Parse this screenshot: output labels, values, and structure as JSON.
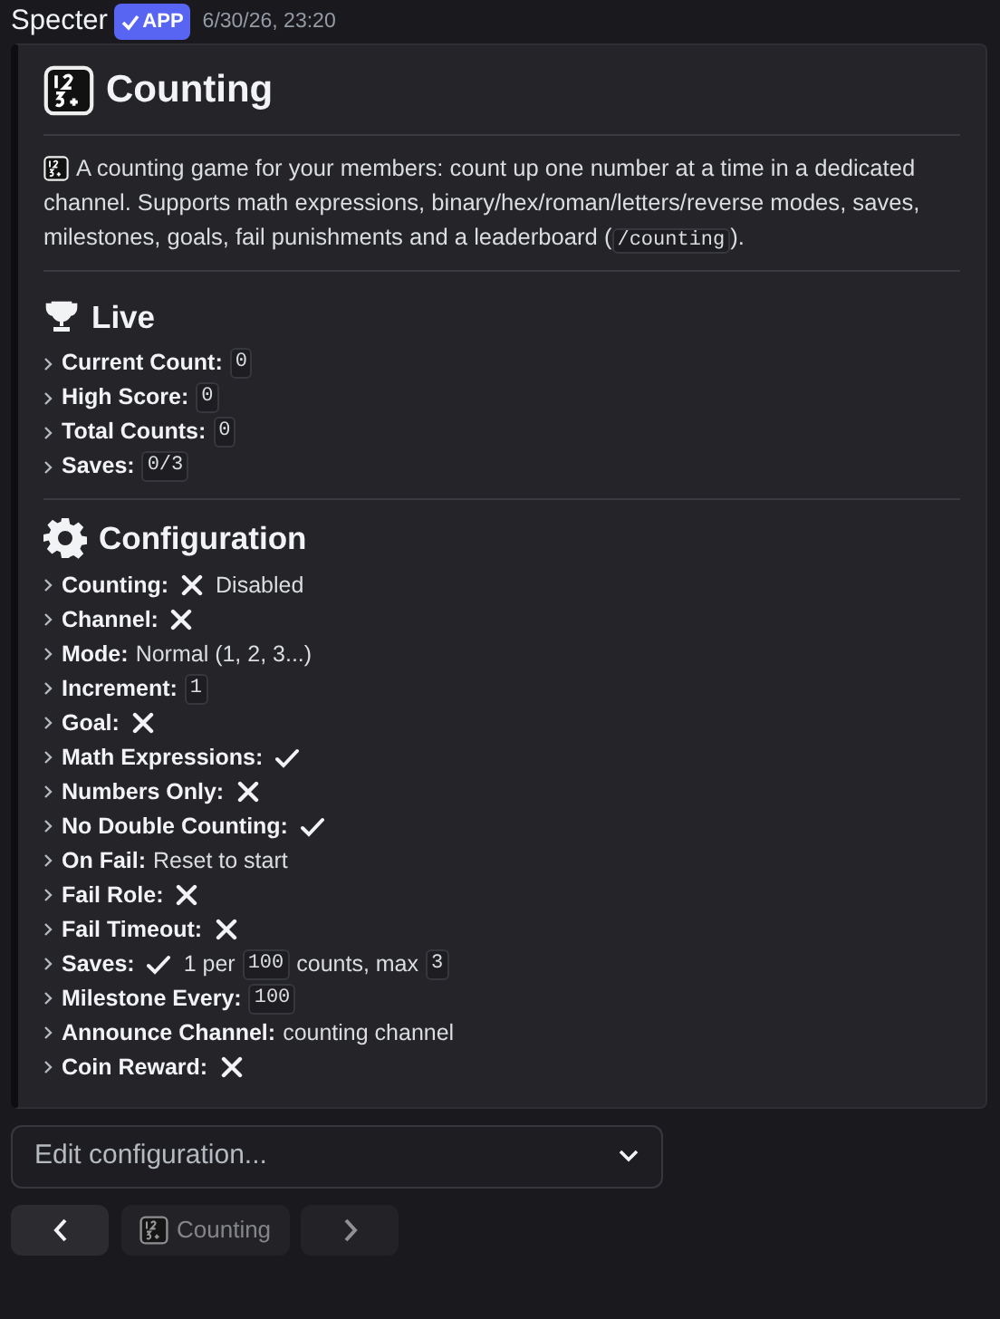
{
  "message": {
    "author": "Specter",
    "badge": "APP",
    "timestamp": "6/30/26, 23:20"
  },
  "embed": {
    "title": "Counting",
    "description": [
      {
        "kind": "text",
        "text": "A counting game for your members: count up one number at a time in a dedicated channel. Supports math expressions, binary/hex/roman/letters/reverse modes, saves, milestones, goals, fail punishments and a leaderboard ("
      },
      {
        "kind": "code",
        "text": "/counting"
      },
      {
        "kind": "text",
        "text": ")."
      }
    ],
    "sections": [
      {
        "kind": "trophy",
        "title": "Live",
        "items": [
          {
            "label": "Current Count:",
            "parts": [
              {
                "kind": "code",
                "text": "0"
              }
            ]
          },
          {
            "label": "High Score:",
            "parts": [
              {
                "kind": "code",
                "text": "0"
              }
            ]
          },
          {
            "label": "Total Counts:",
            "parts": [
              {
                "kind": "code",
                "text": "0"
              }
            ]
          },
          {
            "label": "Saves:",
            "parts": [
              {
                "kind": "code",
                "text": "0/3"
              }
            ]
          }
        ]
      },
      {
        "kind": "gear",
        "title": "Configuration",
        "items": [
          {
            "label": "Counting:",
            "parts": [
              {
                "kind": "cross"
              },
              {
                "kind": "text",
                "text": "Disabled"
              }
            ]
          },
          {
            "label": "Channel:",
            "parts": [
              {
                "kind": "cross"
              }
            ]
          },
          {
            "label": "Mode:",
            "parts": [
              {
                "kind": "text",
                "text": "Normal (1, 2, 3...)"
              }
            ]
          },
          {
            "label": "Increment:",
            "parts": [
              {
                "kind": "code",
                "text": "1"
              }
            ]
          },
          {
            "label": "Goal:",
            "parts": [
              {
                "kind": "cross"
              }
            ]
          },
          {
            "label": "Math Expressions:",
            "parts": [
              {
                "kind": "check"
              }
            ]
          },
          {
            "label": "Numbers Only:",
            "parts": [
              {
                "kind": "cross"
              }
            ]
          },
          {
            "label": "No Double Counting:",
            "parts": [
              {
                "kind": "check"
              }
            ]
          },
          {
            "label": "On Fail:",
            "parts": [
              {
                "kind": "text",
                "text": "Reset to start"
              }
            ]
          },
          {
            "label": "Fail Role:",
            "parts": [
              {
                "kind": "cross"
              }
            ]
          },
          {
            "label": "Fail Timeout:",
            "parts": [
              {
                "kind": "cross"
              }
            ]
          },
          {
            "label": "Saves:",
            "parts": [
              {
                "kind": "check"
              },
              {
                "kind": "text",
                "text": "1 per"
              },
              {
                "kind": "code",
                "text": "100"
              },
              {
                "kind": "text",
                "text": "counts, max"
              },
              {
                "kind": "code",
                "text": "3"
              }
            ]
          },
          {
            "label": "Milestone Every:",
            "parts": [
              {
                "kind": "code",
                "text": "100"
              }
            ]
          },
          {
            "label": "Announce Channel:",
            "parts": [
              {
                "kind": "text",
                "text": "counting channel"
              }
            ]
          },
          {
            "label": "Coin Reward:",
            "parts": [
              {
                "kind": "cross"
              }
            ]
          }
        ]
      }
    ]
  },
  "select": {
    "placeholder": "Edit configuration..."
  },
  "buttons": [
    {
      "kind": "prev",
      "disabled": false
    },
    {
      "kind": "label",
      "text": "Counting",
      "disabled": true
    },
    {
      "kind": "next",
      "disabled": true
    }
  ]
}
